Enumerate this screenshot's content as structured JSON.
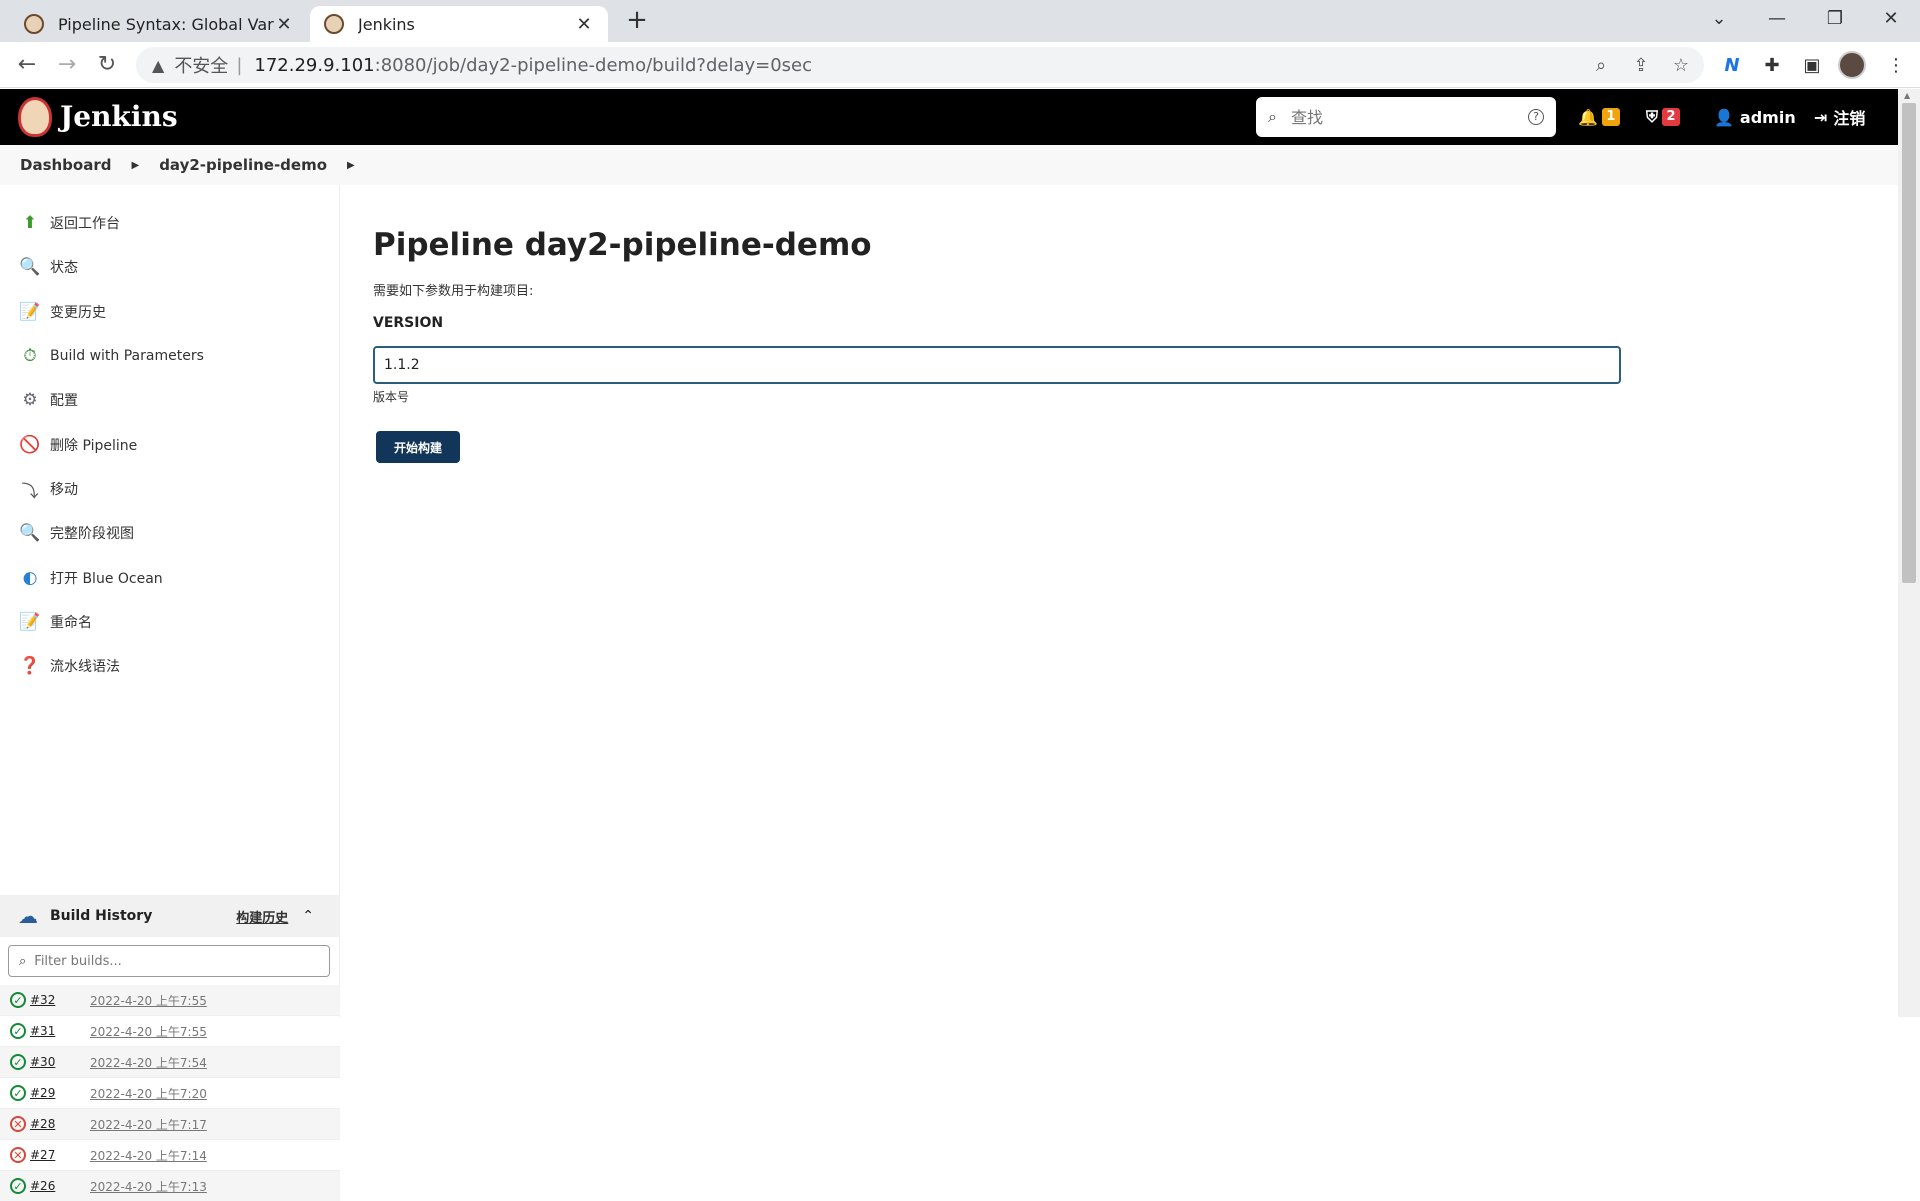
{
  "browser": {
    "tabs": [
      {
        "title": "Pipeline Syntax: Global Variabl",
        "active": false
      },
      {
        "title": "Jenkins",
        "active": true
      }
    ],
    "url_security": "不安全",
    "url_host": "172.29.9.101",
    "url_rest": ":8080/job/day2-pipeline-demo/build?delay=0sec"
  },
  "header": {
    "brand": "Jenkins",
    "search_placeholder": "查找",
    "notifications_count": "1",
    "security_count": "2",
    "user": "admin",
    "logout": "注销"
  },
  "breadcrumb": {
    "items": [
      "Dashboard",
      "day2-pipeline-demo"
    ]
  },
  "sidebar": {
    "items": [
      {
        "label": "返回工作台",
        "icon": "up-arrow-icon"
      },
      {
        "label": "状态",
        "icon": "magnifier-icon"
      },
      {
        "label": "变更历史",
        "icon": "notepad-icon"
      },
      {
        "label": "Build with Parameters",
        "icon": "clock-play-icon"
      },
      {
        "label": "配置",
        "icon": "gear-icon"
      },
      {
        "label": "删除 Pipeline",
        "icon": "no-entry-icon"
      },
      {
        "label": "移动",
        "icon": "move-icon"
      },
      {
        "label": "完整阶段视图",
        "icon": "magnifier-icon"
      },
      {
        "label": "打开 Blue Ocean",
        "icon": "blue-ocean-icon"
      },
      {
        "label": "重命名",
        "icon": "notepad-icon"
      },
      {
        "label": "流水线语法",
        "icon": "help-icon"
      }
    ]
  },
  "build_history": {
    "title": "Build History",
    "trend_link": "构建历史",
    "filter_placeholder": "Filter builds...",
    "builds": [
      {
        "number": "#32",
        "date": "2022-4-20 上午7:55",
        "status": "success"
      },
      {
        "number": "#31",
        "date": "2022-4-20 上午7:55",
        "status": "success"
      },
      {
        "number": "#30",
        "date": "2022-4-20 上午7:54",
        "status": "success"
      },
      {
        "number": "#29",
        "date": "2022-4-20 上午7:20",
        "status": "success"
      },
      {
        "number": "#28",
        "date": "2022-4-20 上午7:17",
        "status": "failed"
      },
      {
        "number": "#27",
        "date": "2022-4-20 上午7:14",
        "status": "failed"
      },
      {
        "number": "#26",
        "date": "2022-4-20 上午7:13",
        "status": "success"
      }
    ]
  },
  "main": {
    "title": "Pipeline day2-pipeline-demo",
    "subtitle": "需要如下参数用于构建项目:",
    "param_name": "VERSION",
    "param_value": "1.1.2",
    "param_description": "版本号",
    "build_button": "开始构建"
  },
  "colors": {
    "header_bg": "#000000",
    "button_bg": "#12365a",
    "input_border": "#2a5e7d",
    "success": "#138a36",
    "failure": "#d24939",
    "badge_orange": "#f0a30a",
    "badge_red": "#e53940"
  }
}
